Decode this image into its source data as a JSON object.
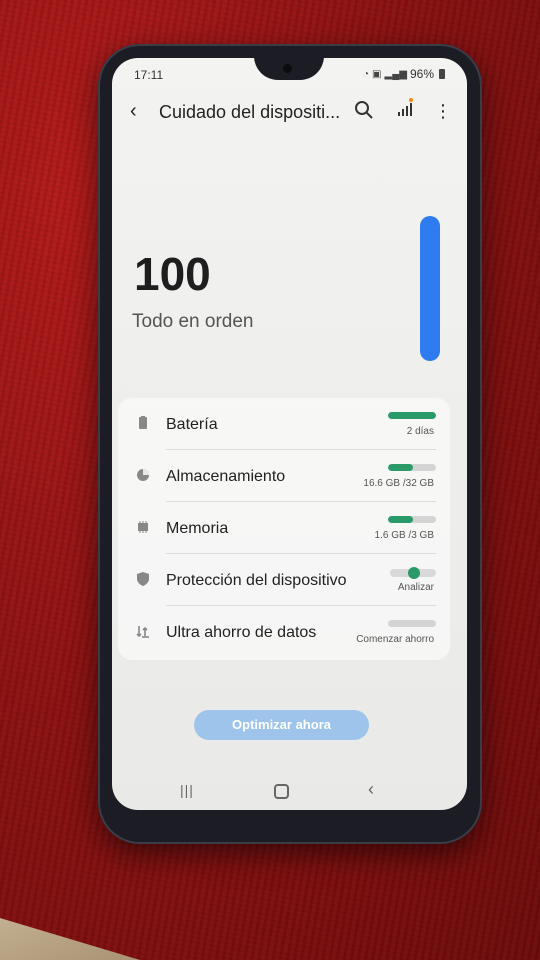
{
  "status_bar": {
    "time": "17:11",
    "battery_percent": "96%",
    "icons": [
      "wifi-icon",
      "volte-icon",
      "signal-bars-icon",
      "battery-icon"
    ]
  },
  "app_bar": {
    "title": "Cuidado del dispositi...",
    "icons": [
      "back-arrow-icon",
      "search-icon",
      "stats-signal-icon",
      "more-vert-icon"
    ]
  },
  "score": {
    "value": "100",
    "status": "Todo en orden",
    "level_fraction": 1.0
  },
  "items": [
    {
      "label": "Batería",
      "value": "2 días",
      "fill": 1.0,
      "icon": "battery-icon"
    },
    {
      "label": "Almacenamiento",
      "value": "16.6 GB /32 GB",
      "fill": 0.52,
      "icon": "storage-pie-icon"
    },
    {
      "label": "Memoria",
      "value": "1.6 GB /3 GB",
      "fill": 0.53,
      "icon": "memory-chip-icon"
    },
    {
      "label": "Protección del dispositivo",
      "value": "Analizar",
      "icon": "shield-icon"
    },
    {
      "label": "Ultra ahorro de datos",
      "value": "Comenzar ahorro",
      "fill": 0.0,
      "icon": "data-saver-icon"
    }
  ],
  "cta": {
    "label": "Optimizar ahora"
  },
  "nav_bar": {
    "icons": [
      "recent-apps-icon",
      "home-icon",
      "back-icon"
    ]
  },
  "colors": {
    "accent_blue": "#2f7bf0",
    "progress_green": "#2a9a68",
    "button_blue": "#9ec4ec",
    "background_red": "#a31616"
  }
}
